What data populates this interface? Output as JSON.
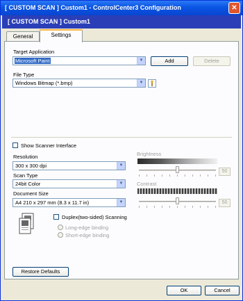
{
  "window": {
    "title": "[  CUSTOM SCAN  ]   Custom1 - ControlCenter3 Configuration",
    "close_glyph": "✕"
  },
  "banner": {
    "text": "[  CUSTOM SCAN  ]   Custom1"
  },
  "tabs": [
    {
      "label": "General"
    },
    {
      "label": "Settings"
    }
  ],
  "target_application": {
    "label": "Target Application",
    "value": "Microsoft Paint",
    "add_label": "Add",
    "delete_label": "Delete"
  },
  "file_type": {
    "label": "File Type",
    "value": "Windows Bitmap (*.bmp)"
  },
  "show_scanner_interface": {
    "label": "Show Scanner Interface"
  },
  "resolution": {
    "label": "Resolution",
    "value": "300 x 300 dpi"
  },
  "scan_type": {
    "label": "Scan Type",
    "value": "24bit Color"
  },
  "document_size": {
    "label": "Document Size",
    "value": "A4 210 x 297 mm (8.3 x 11.7 in)"
  },
  "duplex": {
    "label": "Duplex(two-sided) Scanning",
    "long_edge": "Long-edge binding",
    "short_edge": "Short-edge binding"
  },
  "brightness": {
    "label": "Brightness",
    "value": "50",
    "level_percent": 50
  },
  "contrast": {
    "label": "Contrast",
    "value": "50",
    "level_percent": 50
  },
  "footer": {
    "restore_defaults": "Restore Defaults",
    "ok": "OK",
    "cancel": "Cancel"
  },
  "colors": {
    "titlebar": "#0a54e3",
    "banner": "#2a3fb7",
    "selection": "#316ac5",
    "tab_accent": "#f9b448"
  },
  "icons": {
    "dropdown": "chevron-down-icon",
    "file_type_settings": "settings-icon",
    "duplex_document": "document-icon"
  }
}
